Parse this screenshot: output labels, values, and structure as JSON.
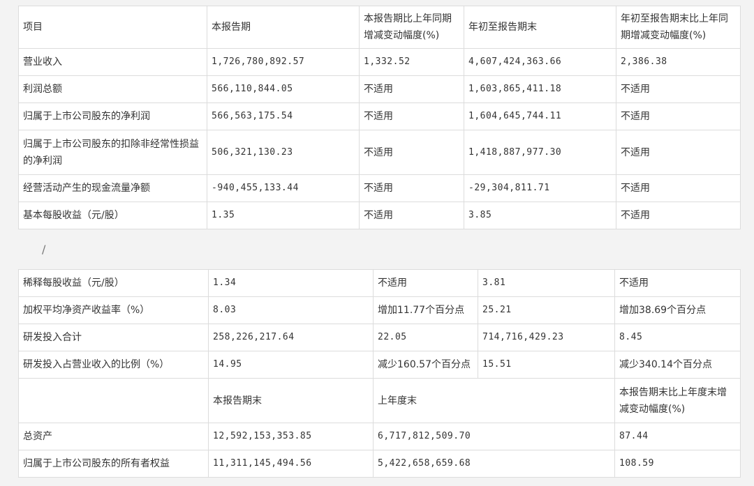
{
  "table1": {
    "header": [
      "项目",
      "本报告期",
      "本报告期比上年同期增减变动幅度(%)",
      "年初至报告期末",
      "年初至报告期末比上年同期增减变动幅度(%)"
    ],
    "rows": [
      [
        "营业收入",
        "1,726,780,892.57",
        "1,332.52",
        "4,607,424,363.66",
        "2,386.38"
      ],
      [
        "利润总额",
        "566,110,844.05",
        "不适用",
        "1,603,865,411.18",
        "不适用"
      ],
      [
        "归属于上市公司股东的净利润",
        "566,563,175.54",
        "不适用",
        "1,604,645,744.11",
        "不适用"
      ],
      [
        "归属于上市公司股东的扣除非经常性损益的净利润",
        "506,321,130.23",
        "不适用",
        "1,418,887,977.30",
        "不适用"
      ],
      [
        "经营活动产生的现金流量净额",
        "-940,455,133.44",
        "不适用",
        "-29,304,811.71",
        "不适用"
      ],
      [
        "基本每股收益（元/股）",
        "1.35",
        "不适用",
        "3.85",
        "不适用"
      ]
    ]
  },
  "separator": "/",
  "table2": {
    "rows": [
      [
        "稀释每股收益（元/股）",
        "1.34",
        "不适用",
        "3.81",
        "不适用"
      ],
      [
        "加权平均净资产收益率（%）",
        "8.03",
        "增加11.77个百分点",
        "25.21",
        "增加38.69个百分点"
      ],
      [
        "研发投入合计",
        "258,226,217.64",
        "22.05",
        "714,716,429.23",
        "8.45"
      ],
      [
        "研发投入占营业收入的比例（%）",
        "14.95",
        "减少160.57个百分点",
        "15.51",
        "减少340.14个百分点"
      ]
    ],
    "subheader": [
      "",
      "本报告期末",
      "上年度末",
      "本报告期末比上年度末增减变动幅度(%)"
    ],
    "balance_rows": [
      [
        "总资产",
        "12,592,153,353.85",
        "6,717,812,509.70",
        "87.44"
      ],
      [
        "归属于上市公司股东的所有者权益",
        "11,311,145,494.56",
        "5,422,658,659.68",
        "108.59"
      ]
    ]
  }
}
